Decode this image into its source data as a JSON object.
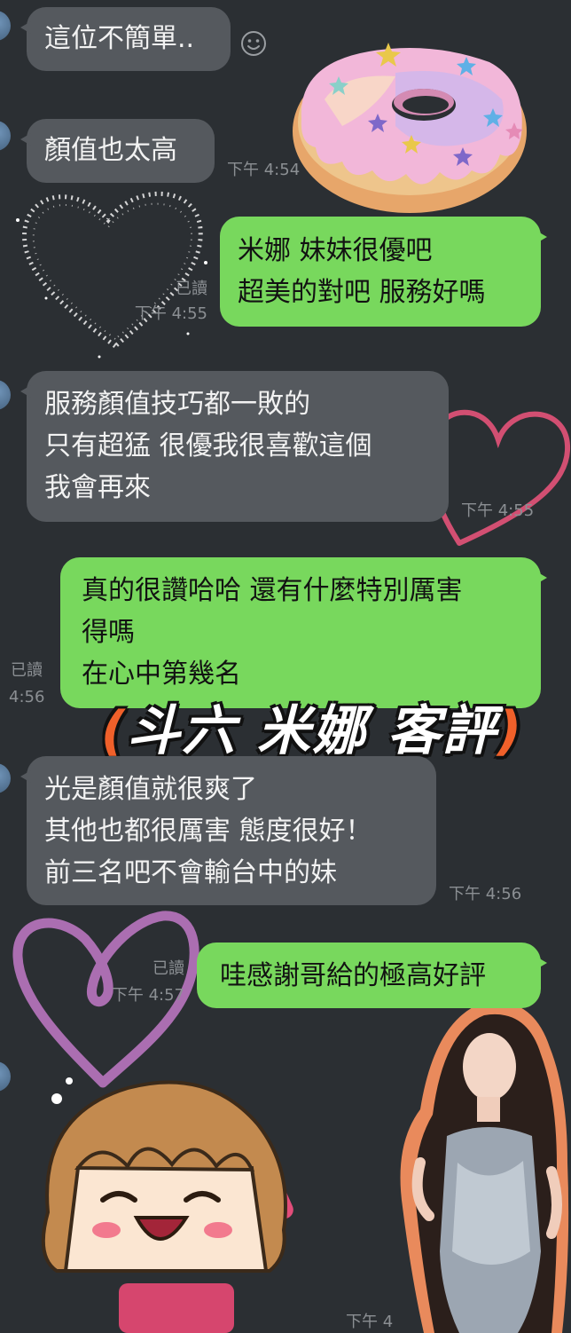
{
  "theme": {
    "background": "#2b2f33",
    "incoming_bubble": "#55595e",
    "outgoing_bubble": "#78d85d",
    "meta_text": "#8b8f93",
    "accent_orange": "#f0602a"
  },
  "messages": [
    {
      "direction": "in",
      "lines": [
        "這位不簡單.."
      ]
    },
    {
      "direction": "in",
      "lines": [
        "顏值也太高"
      ],
      "time": "下午 4:54"
    },
    {
      "direction": "out",
      "lines": [
        "米娜 妹妹很優吧",
        "超美的對吧 服務好嗎"
      ],
      "read": "已讀",
      "time": "下午 4:55"
    },
    {
      "direction": "in",
      "lines": [
        "服務顏值技巧都一敗的",
        "只有超猛 很優我很喜歡這個",
        "我會再來"
      ],
      "time": "下午 4:55"
    },
    {
      "direction": "out",
      "lines": [
        "真的很讚哈哈 還有什麼特別厲害",
        "得嗎",
        "在心中第幾名"
      ],
      "read": "已讀",
      "time": "4:56"
    },
    {
      "direction": "in",
      "lines": [
        "光是顏值就很爽了",
        "其他也都很厲害 態度很好！",
        "前三名吧不會輸台中的妹"
      ],
      "time": "下午 4:56"
    },
    {
      "direction": "out",
      "lines": [
        "哇感謝哥給的極高好評"
      ],
      "read": "已讀",
      "time": "下午 4:57"
    }
  ],
  "footer_time": "下午 4",
  "banner": {
    "open": "(",
    "text": "斗六 米娜 客評",
    "close": ")"
  },
  "icons": {
    "emoji": "smiley-icon",
    "donut": "donut-sticker",
    "sparkle_heart": "sparkle-heart-icon",
    "pink_heart": "heart-outline-icon",
    "cartoon": "cartoon-girl-sticker",
    "photo": "woman-photo-cutout"
  }
}
